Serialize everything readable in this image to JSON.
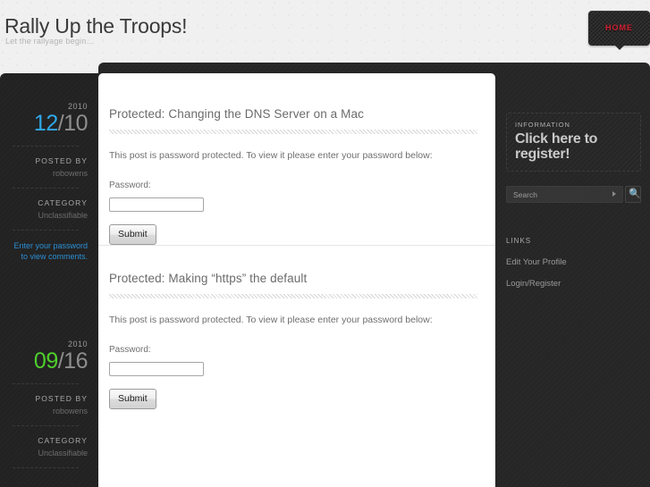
{
  "header": {
    "title": "Rally Up the Troops!",
    "tagline": "Let the rallyage begin…",
    "home_button": "HOME"
  },
  "posts": [
    {
      "year": "2010",
      "day": "12",
      "month": "/10",
      "posted_by_label": "POSTED BY",
      "author": "robowens",
      "category_label": "CATEGORY",
      "category": "Unclassifiable",
      "comment_link": "Enter your password to view comments.",
      "title": "Protected: Changing the DNS Server on a Mac",
      "body": "This post is password protected. To view it please enter your password below:",
      "password_label": "Password:",
      "password_value": "",
      "submit_label": "Submit"
    },
    {
      "year": "2010",
      "day": "09",
      "month": "/16",
      "posted_by_label": "POSTED BY",
      "author": "robowens",
      "category_label": "CATEGORY",
      "category": "Unclassifiable",
      "title": "Protected: Making “https” the default",
      "body": "This post is password protected. To view it please enter your password below:",
      "password_label": "Password:",
      "password_value": "",
      "submit_label": "Submit"
    }
  ],
  "sidebar": {
    "register_widget": {
      "label": "INFORMATION",
      "headline": "Click here to register!"
    },
    "search": {
      "placeholder": "Search",
      "value": "",
      "icon": "search-icon"
    },
    "links_widget": {
      "title": "LINKS",
      "items": [
        {
          "label": "Edit Your Profile"
        },
        {
          "label": "Login/Register"
        }
      ]
    }
  },
  "colors": {
    "page_background": "#f0f0f0",
    "dark_panel": "#262626",
    "meta_column": "#222222",
    "accent_blue": "#2fa8e8",
    "accent_green": "#4ed02c",
    "home_red": "#d31f30",
    "link_blue": "#2b8fd4"
  }
}
